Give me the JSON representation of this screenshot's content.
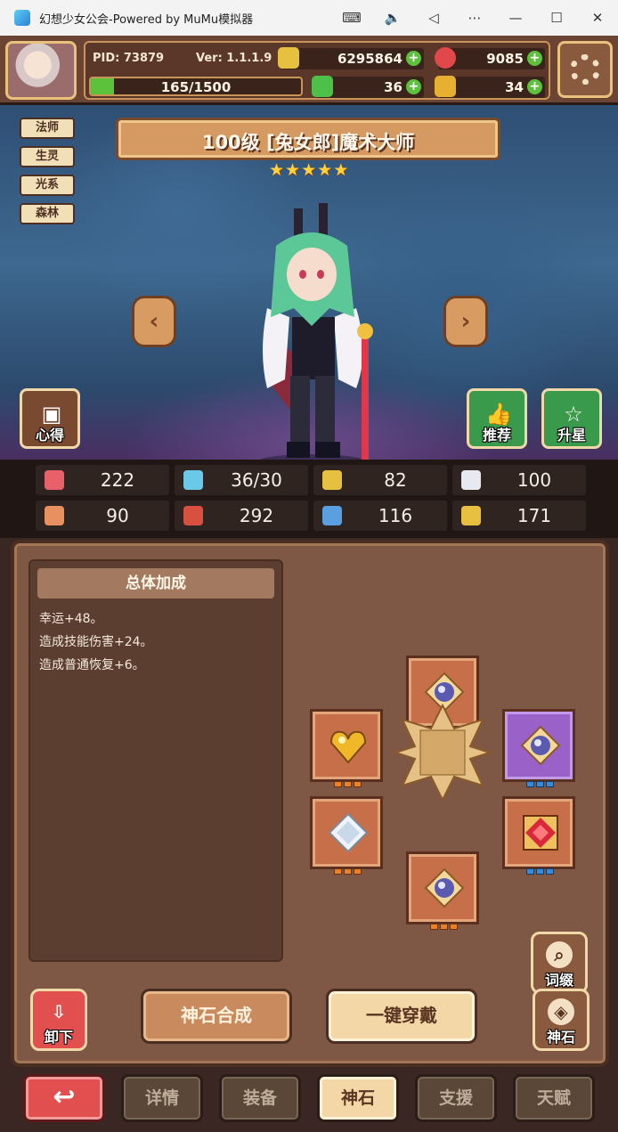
{
  "window": {
    "title": "幻想少女公会-Powered by MuMu模拟器",
    "controls": [
      "keyboard-icon",
      "volume-icon",
      "back-icon",
      "more-icon",
      "minimize-icon",
      "maximize-icon",
      "close-icon"
    ]
  },
  "hud": {
    "pid": "PID: 73879",
    "version": "Ver: 1.1.1.9",
    "gold": "6295864",
    "gems": "9085",
    "exp": "165/1500",
    "exp_fraction": 0.11,
    "clover": "36",
    "key": "34"
  },
  "hero": {
    "title": "100级 [兔女郎]魔术大师",
    "stars": [
      "★",
      "★",
      "★",
      "★",
      "★"
    ],
    "tags": [
      "法师",
      "生灵",
      "光系",
      "森林"
    ],
    "prev": "‹",
    "next": "›"
  },
  "scene_buttons": {
    "notes": "心得",
    "recommend": "推荐",
    "star_up": "升星"
  },
  "stats": [
    {
      "icon": "heart-icon",
      "value": "222",
      "color": "#e8606a"
    },
    {
      "icon": "water-drop-icon",
      "value": "36/30",
      "color": "#6ac8e8"
    },
    {
      "icon": "shield-icon",
      "value": "82",
      "color": "#e8c040"
    },
    {
      "icon": "wing-icon",
      "value": "100",
      "color": "#e8e8f0"
    },
    {
      "icon": "fist-icon",
      "value": "90",
      "color": "#e89060"
    },
    {
      "icon": "book-icon",
      "value": "292",
      "color": "#d85040"
    },
    {
      "icon": "boot-icon",
      "value": "116",
      "color": "#5aa0e0"
    },
    {
      "icon": "horseshoe-icon",
      "value": "171",
      "color": "#e8c040"
    }
  ],
  "bonus": {
    "title": "总体加成",
    "lines": [
      "幸运+48。",
      "造成技能伤害+24。",
      "造成普通恢复+6。"
    ]
  },
  "panel_buttons": {
    "affix": "词缀",
    "unload": "卸下",
    "synthesis": "神石合成",
    "equip_all": "一键穿戴",
    "godstone": "神石"
  },
  "tabs": {
    "back": "↩",
    "details": "详情",
    "equipment": "装备",
    "godstone": "神石",
    "support": "支援",
    "talent": "天赋"
  }
}
